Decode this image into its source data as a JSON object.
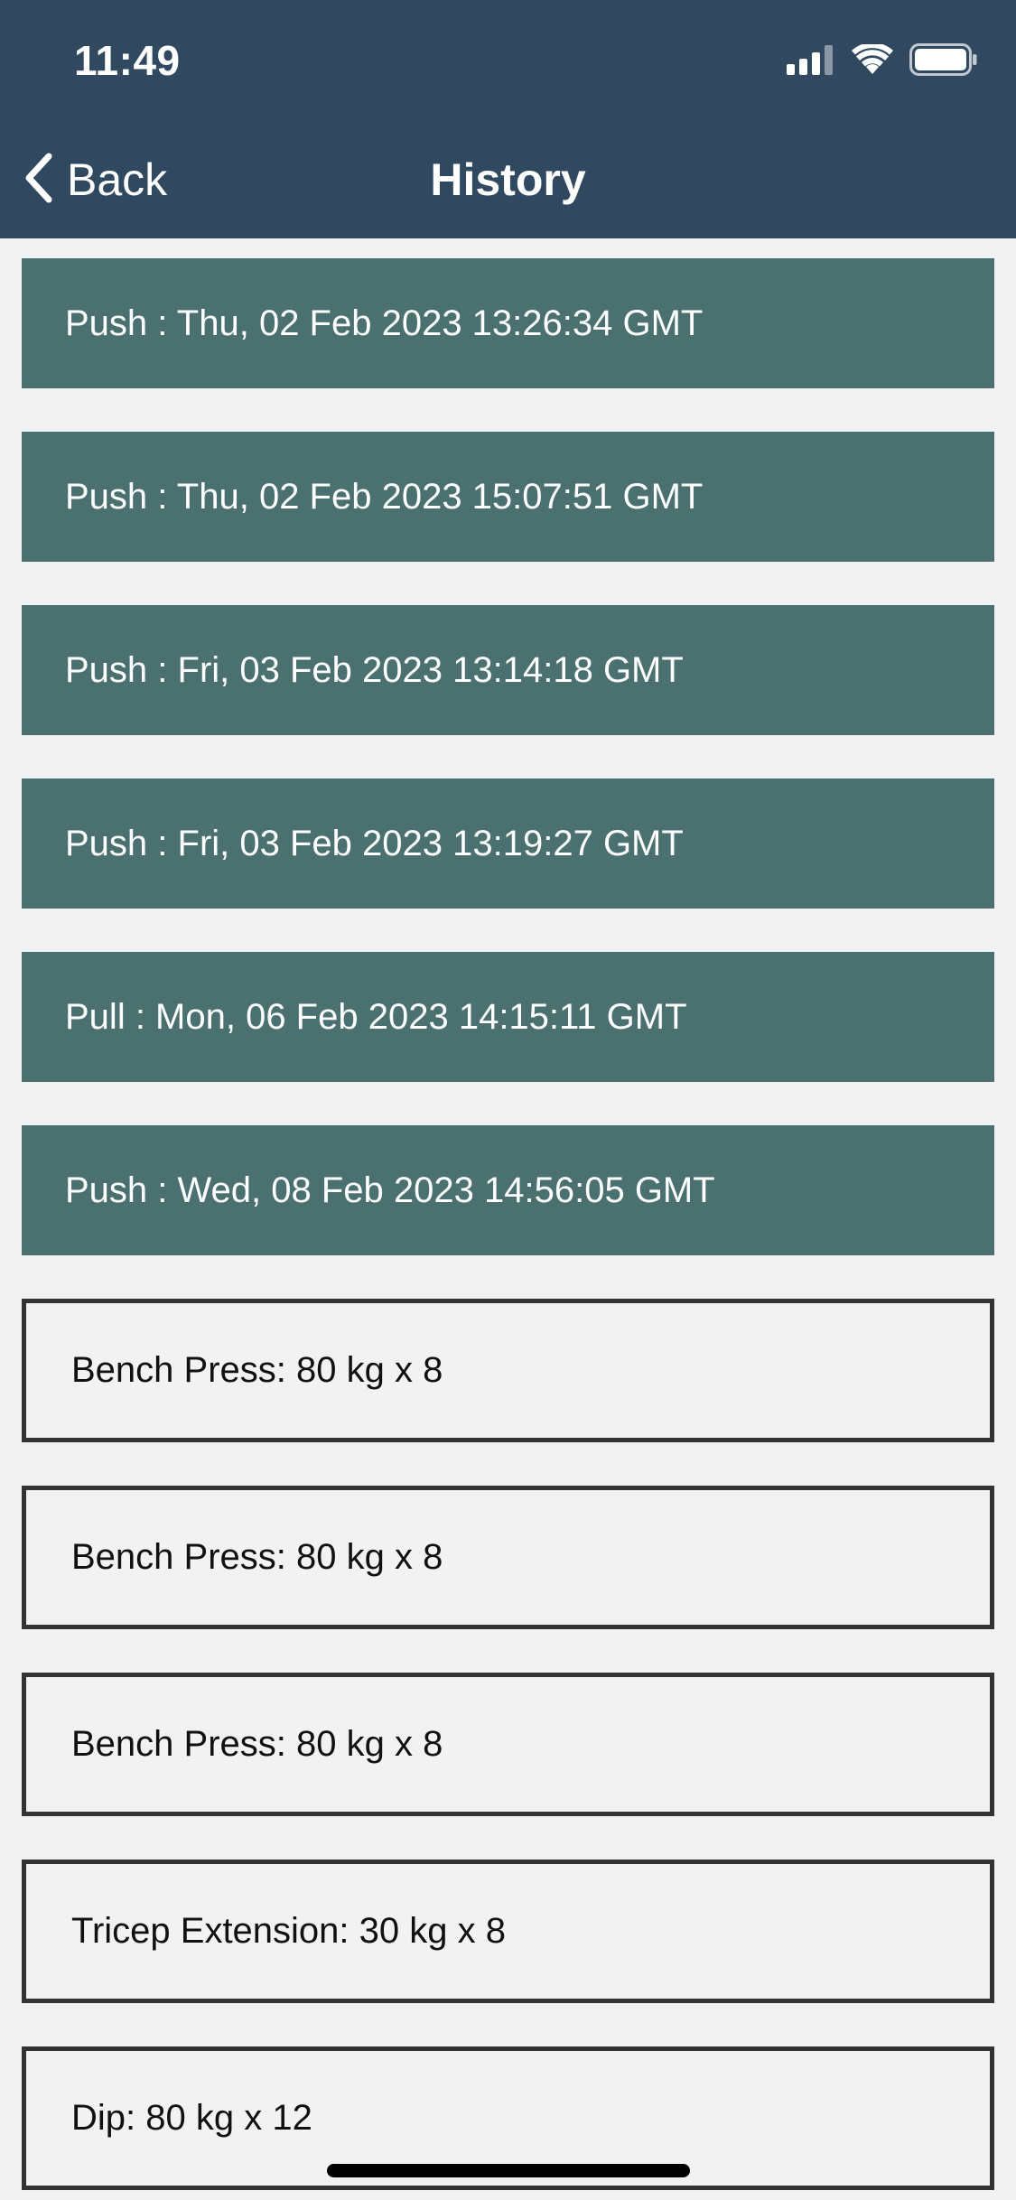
{
  "status_bar": {
    "time": "11:49",
    "icons": [
      "cellular-signal-icon",
      "wifi-icon",
      "battery-icon"
    ]
  },
  "nav": {
    "back_label": "Back",
    "title": "History"
  },
  "sessions": [
    {
      "label": "Push : Thu, 02 Feb 2023 13:26:34 GMT"
    },
    {
      "label": "Push : Thu, 02 Feb 2023 15:07:51 GMT"
    },
    {
      "label": "Push : Fri, 03 Feb 2023 13:14:18 GMT"
    },
    {
      "label": "Push : Fri, 03 Feb 2023 13:19:27 GMT"
    },
    {
      "label": "Pull : Mon, 06 Feb 2023 14:15:11 GMT"
    },
    {
      "label": "Push : Wed, 08 Feb 2023 14:56:05 GMT"
    }
  ],
  "sets": [
    {
      "label": "Bench Press: 80 kg x 8"
    },
    {
      "label": "Bench Press: 80 kg x 8"
    },
    {
      "label": "Bench Press: 80 kg x 8"
    },
    {
      "label": "Tricep Extension: 30 kg x 8"
    },
    {
      "label": "Dip: 80 kg x 12"
    }
  ],
  "colors": {
    "header_bg": "#304960",
    "session_bg": "#4a7070",
    "page_bg": "#f2f2f2",
    "set_border": "#333333"
  }
}
